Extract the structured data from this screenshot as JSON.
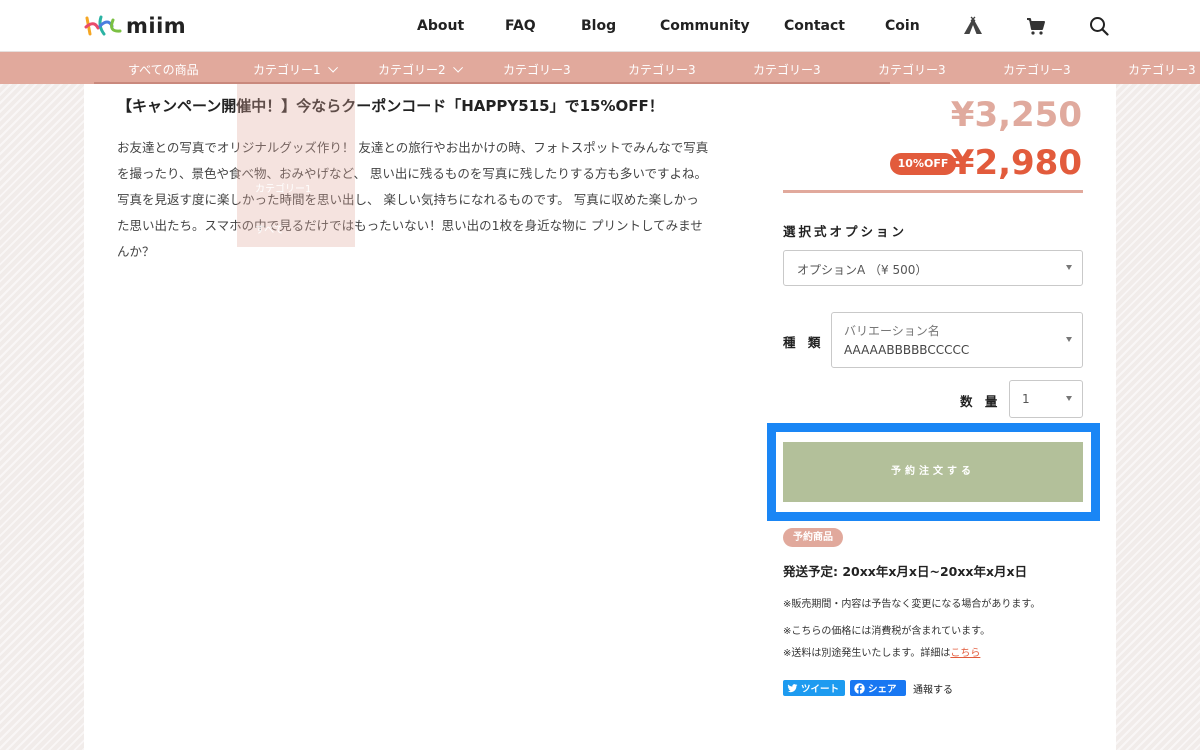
{
  "header": {
    "logo_text": "miim",
    "nav": [
      "About",
      "FAQ",
      "Blog",
      "Community",
      "Contact",
      "Coin"
    ],
    "icons": [
      "tent-icon",
      "cart-icon",
      "search-icon"
    ]
  },
  "categories": {
    "items": [
      "すべての商品",
      "カテゴリー1",
      "カテゴリー2",
      "カテゴリー3",
      "カテゴリー3",
      "カテゴリー3",
      "カテゴリー3",
      "カテゴリー3",
      "カテゴリー3"
    ],
    "dropdown_ghost": [
      "カテゴリー1",
      "すべて"
    ]
  },
  "content": {
    "headline": "【キャンペーン開催中！】今ならクーポンコード「HAPPY515」で15%OFF！",
    "description": [
      "お友達との写真でオリジナルグッズ作り！ 友達との旅行やお出かけの時、フォトスポットでみんなで写真",
      "を撮ったり、景色や食べ物、おみやげなど、 思い出に残るものを写真に残したりする方も多いですよね。",
      "写真を見返す度に楽しかった時間を思い出し、 楽しい気持ちになれるものです。 写真に収めた楽しかっ",
      "た思い出たち。スマホの中で見るだけではもったいない！思い出の1枚を身近な物に プリントしてみませ",
      "んか？"
    ]
  },
  "product": {
    "price_original": "¥3,250",
    "discount_badge": "10%OFF",
    "price_sale": "¥2,980",
    "option_title": "選択式オプション",
    "option_value": "オプションA （¥ 500）",
    "kind_label": "種 類",
    "variation_placeholder": "バリエーション名",
    "variation_value": "AAAAABBBBBCCCCC",
    "qty_label": "数 量",
    "qty_value": "1",
    "order_button": "予約注文する",
    "preorder_badge": "予約商品",
    "ship_date": "発送予定: 20xx年x月x日~20xx年x月x日",
    "notes": [
      "※販売期間・内容は予告なく変更になる場合があります。",
      "※こちらの価格には消費税が含まれています。"
    ],
    "note_shipping": "※送料は別途発生いたします。詳細は",
    "note_link": "こちら",
    "share": {
      "tweet": "ツイート",
      "facebook": "シェア",
      "report": "通報する"
    }
  },
  "colors": {
    "accent": "#e1a99c",
    "sale": "#e25b3c",
    "button": "#b3c09a",
    "highlight": "#1a86f5"
  }
}
